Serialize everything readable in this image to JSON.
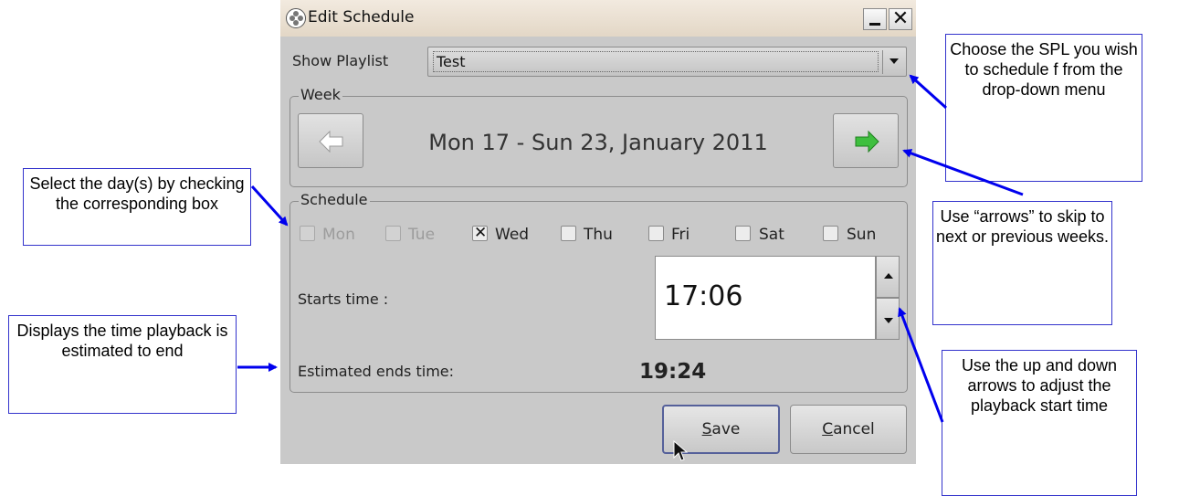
{
  "window": {
    "title": "Edit Schedule",
    "minimize_label": "_",
    "close_label": "✕"
  },
  "playlist": {
    "label": "Show Playlist",
    "selected": "Test"
  },
  "week": {
    "group_title": "Week",
    "range_text": "Mon 17 - Sun 23, January 2011"
  },
  "schedule": {
    "group_title": "Schedule",
    "days": [
      {
        "label": "Mon",
        "checked": false,
        "enabled": false
      },
      {
        "label": "Tue",
        "checked": false,
        "enabled": false
      },
      {
        "label": "Wed",
        "checked": true,
        "enabled": true
      },
      {
        "label": "Thu",
        "checked": false,
        "enabled": true
      },
      {
        "label": "Fri",
        "checked": false,
        "enabled": true
      },
      {
        "label": "Sat",
        "checked": false,
        "enabled": true
      },
      {
        "label": "Sun",
        "checked": false,
        "enabled": true
      }
    ],
    "start_label": "Starts time :",
    "start_value": "17:06",
    "end_label": "Estimated ends time:",
    "end_value": "19:24"
  },
  "buttons": {
    "save": "Save",
    "cancel": "Cancel"
  },
  "callouts": {
    "spl": "Choose the SPL you wish to schedule f from the drop-down menu",
    "arrows": "Use “arrows” to skip to next or previous weeks.",
    "days": "Select the day(s) by checking the corresponding box",
    "end_time": "Displays the time playback is estimated to end",
    "start_time": "Use the up and down arrows to adjust the playback start time"
  },
  "colors": {
    "dialog_bg": "#c9c9c9",
    "titlebar": "#e9e0d2",
    "callout_border": "#3333cc",
    "arrow_blue": "#0000ee",
    "next_arrow_green": "#3fbf3f",
    "default_button_border": "#55609a"
  }
}
